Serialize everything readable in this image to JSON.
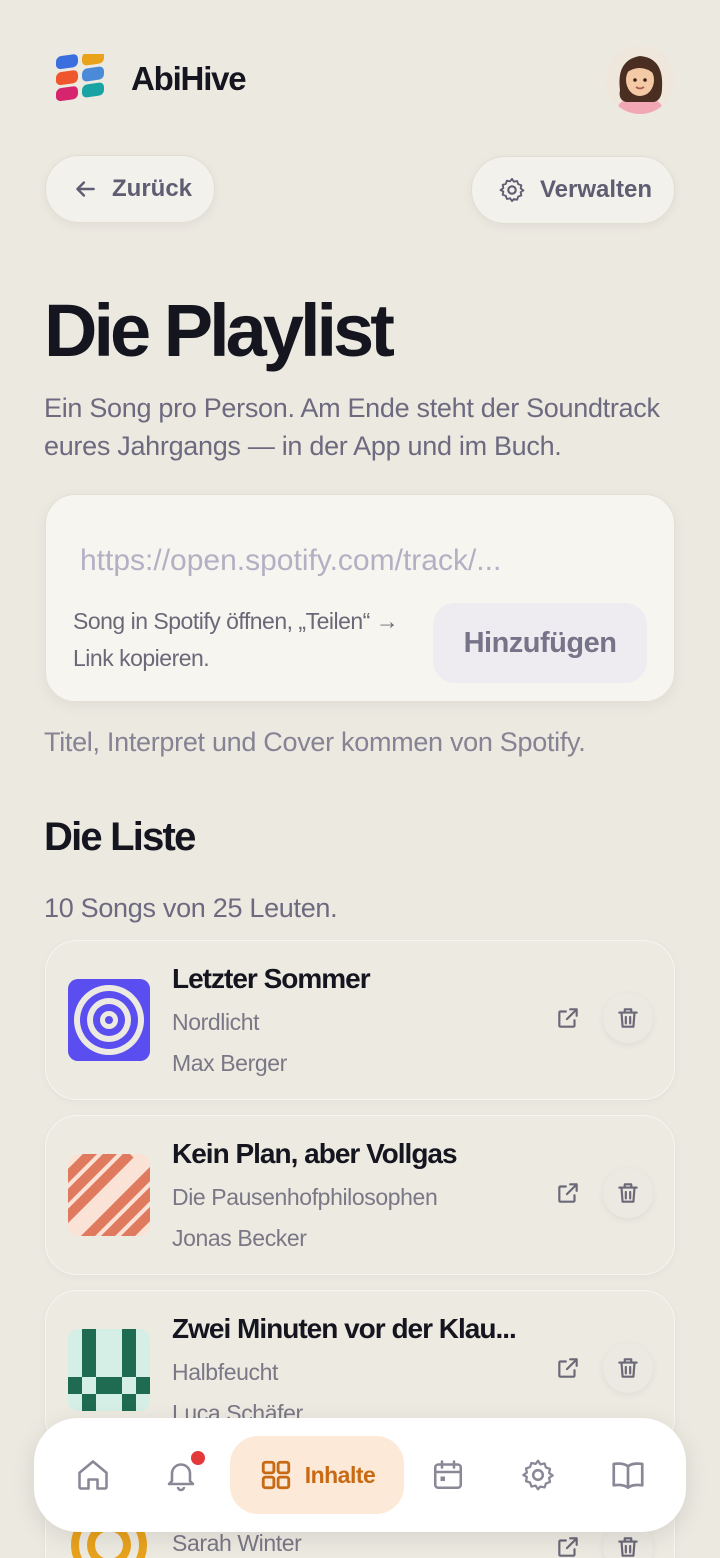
{
  "header": {
    "brand": "AbiHive"
  },
  "nav_buttons": {
    "back_label": "Zurück",
    "manage_label": "Verwalten"
  },
  "page": {
    "title": "Die Playlist",
    "subtitle": "Ein Song pro Person. Am Ende steht der Soundtrack eures Jahrgangs — in der App und im Buch."
  },
  "add_song": {
    "placeholder": "https://open.spotify.com/track/...",
    "hint": "Song in Spotify öffnen, „Teilen“ → Link kopieren.",
    "button_label": "Hinzufügen",
    "source_note": "Titel, Interpret und Cover kommen von Spotify."
  },
  "list": {
    "title": "Die Liste",
    "count_text": "10 Songs von 25 Leuten."
  },
  "songs": [
    {
      "title": "Letzter Sommer",
      "artist": "Nordlicht",
      "added_by": "Max Berger",
      "cover": "concentric-rings-purple"
    },
    {
      "title": "Kein Plan, aber Vollgas",
      "artist": "Die Pausenhofphilosophen",
      "added_by": "Jonas Becker",
      "cover": "diagonal-stripes-coral"
    },
    {
      "title": "Zwei Minuten vor der Klau...",
      "artist": "Halbfeucht",
      "added_by": "Luca Schäfer",
      "cover": "checker-green"
    },
    {
      "title": "",
      "artist": "",
      "added_by": "Sarah Winter",
      "cover": "concentric-rings-orange"
    }
  ],
  "bottom_nav": {
    "active_label": "Inhalte",
    "items": [
      "home-icon",
      "bell-icon",
      "grid-icon",
      "calendar-icon",
      "gear-icon",
      "book-icon"
    ]
  },
  "colors": {
    "background": "#ece9e1",
    "accent": "#c86a14",
    "accent_bg": "#fde9d7",
    "notification": "#e5383b"
  }
}
